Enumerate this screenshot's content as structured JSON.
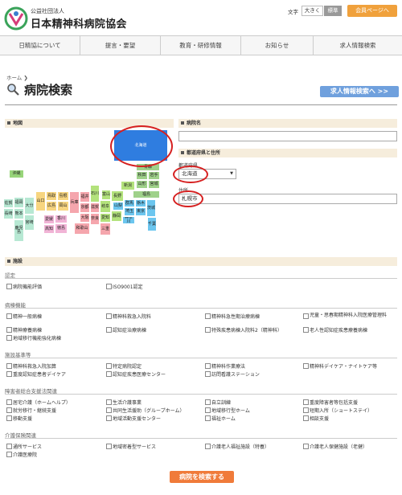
{
  "header": {
    "org_sub": "公益社団法人",
    "org_name": "日本精神科病院協会",
    "text_size_label": "文字",
    "size_large": "大きく",
    "size_standard": "標準",
    "member_page": "会員ページへ"
  },
  "nav": [
    "日精協について",
    "提言・要望",
    "教育・研修情報",
    "お知らせ",
    "求人情報検索"
  ],
  "breadcrumb": "ホーム ❯",
  "page_title": "病院検索",
  "job_search_button": "求人情報検索へ >>",
  "map_section": {
    "label": "地図",
    "prefectures": {
      "hokkaido": "北海道",
      "aomori": "青森",
      "akita": "秋田",
      "iwate": "岩手",
      "yamagata": "山形",
      "miyagi": "宮城",
      "niigata": "新潟",
      "fukushima": "福島",
      "toyama": "富山",
      "ishikawa": "石川",
      "nagano": "長野",
      "gunma": "群馬",
      "tochigi": "栃木",
      "ibaraki": "茨城",
      "yamanashi": "山梨",
      "saitama": "埼玉",
      "chiba": "千葉",
      "tokyo": "東京",
      "kanagawa": "神奈川",
      "shizuoka": "静岡",
      "aichi": "愛知",
      "gifu": "岐阜",
      "fukui": "福井",
      "shiga": "滋賀",
      "kyoto": "京都",
      "osaka": "大阪",
      "hyogo": "兵庫",
      "nara": "奈良",
      "wakayama": "和歌山",
      "mie": "三重",
      "tottori": "鳥取",
      "shimane": "島根",
      "okayama": "岡山",
      "hiroshima": "広島",
      "yamaguchi": "山口",
      "kagawa": "香川",
      "tokushima": "徳島",
      "ehime": "愛媛",
      "kochi": "高知",
      "fukuoka": "福岡",
      "saga": "佐賀",
      "nagasaki": "長崎",
      "oita": "大分",
      "kumamoto": "熊本",
      "miyazaki": "宮崎",
      "kagoshima": "鹿児島",
      "okinawa": "沖縄"
    }
  },
  "hospital_name": {
    "label": "病院名",
    "value": ""
  },
  "address_section": {
    "label": "都道府県と住所",
    "pref_label": "都道府県",
    "pref_value": "北海道",
    "address_label": "住所",
    "address_value": "札幌市"
  },
  "facility": {
    "label": "施設",
    "categories": [
      {
        "title": "認定",
        "items": [
          "病院機能評価",
          "ISO9001認定"
        ]
      },
      {
        "title": "病棟機能",
        "items": [
          "精神一般病棟",
          "精神科救急入院料",
          "精神科急性期治療病棟",
          "児童・思春期精神科入院医療管理料",
          "精神療養病棟",
          "認知症治療病棟",
          "特殊疾患病棟入院料2（精神科）",
          "老人性認知症疾患療養病棟",
          "地域移行機能強化病棟"
        ]
      },
      {
        "title": "施設基準等",
        "items": [
          "精神科救急入院加算",
          "特定病院認定",
          "精神科作業療法",
          "精神科デイケア・ナイトケア等",
          "重度認知症患者デイケア",
          "認知症疾患医療センター",
          "訪問看護ステーション"
        ]
      },
      {
        "title": "障害者総合支援法関連",
        "items": [
          "居宅介護（ホームヘルプ）",
          "生活介護事業",
          "自立訓練",
          "重度障害者等包括支援",
          "就労移行・継続支援",
          "共同生活援助（グループホーム）",
          "地域移行型ホーム",
          "短期入所（ショートステイ）",
          "移動支援",
          "地域活動支援センター",
          "福祉ホーム",
          "相談支援"
        ]
      },
      {
        "title": "介護保険関連",
        "items": [
          "通所サービス",
          "地域密着型サービス",
          "介護老人福祉施設（特養）",
          "介護老人保健施設（老健）",
          "介護医療院"
        ]
      }
    ]
  },
  "submit_label": "病院を検索する",
  "colors": {
    "accent_orange": "#f07b3a",
    "link_blue": "#6fa0dd",
    "annotation_red": "#d62020"
  }
}
